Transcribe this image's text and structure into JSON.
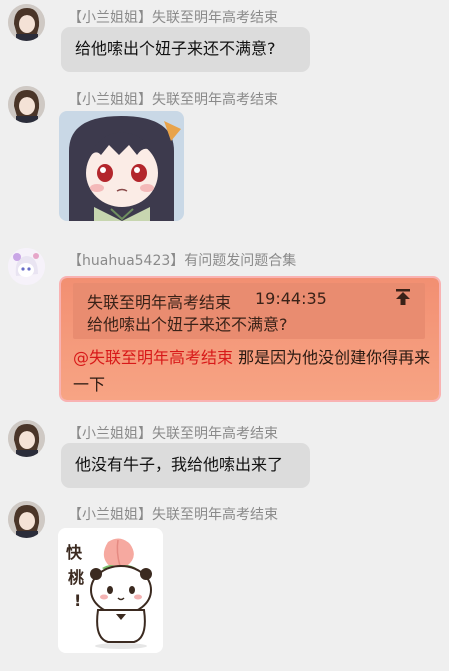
{
  "messages": [
    {
      "sender": "【小兰姐姐】失联至明年高考结束",
      "text": "给他嗦出个妞子来还不满意?"
    },
    {
      "sender": "【小兰姐姐】失联至明年高考结束",
      "image": "anime-girl-sticker"
    },
    {
      "sender": "【huahua5423】有问题发问题合集",
      "quote": {
        "author": "失联至明年高考结束",
        "time": "19:44:35",
        "text": "给他嗦出个妞子来还不满意?"
      },
      "mention": "@失联至明年高考结束",
      "text": " 那是因为他没创建你得再来一下"
    },
    {
      "sender": "【小兰姐姐】失联至明年高考结束",
      "text": "他没有牛子，我给他嗦出来了"
    },
    {
      "sender": "【小兰姐姐】失联至明年高考结束",
      "image": "panda-peach-sticker",
      "sticker_text": [
        "快",
        "桃",
        "!"
      ]
    }
  ],
  "colors": {
    "background": "#efefef",
    "bubble": "#dcdcdc",
    "reply_bubble": "#f7a484",
    "mention": "#d81919"
  }
}
